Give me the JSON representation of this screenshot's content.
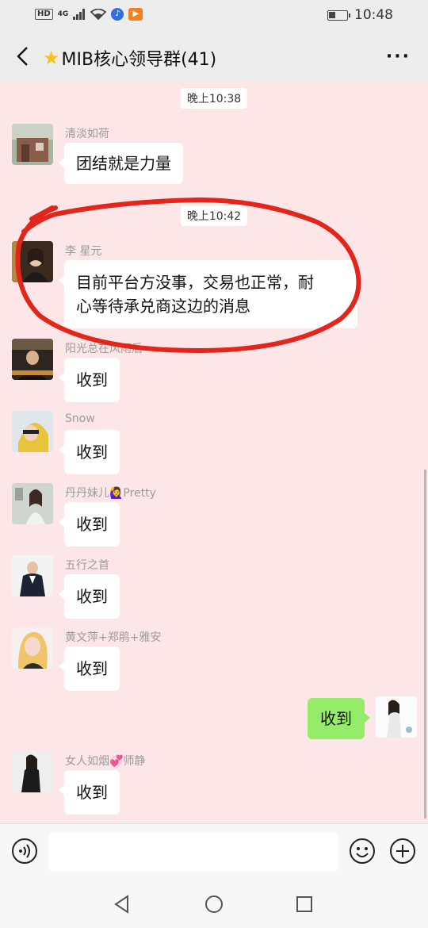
{
  "status_bar": {
    "left": {
      "hd": "HD",
      "network": "4G"
    },
    "right": {
      "battery_percent": 40,
      "time": "10:48"
    }
  },
  "header": {
    "title": "MIB核心领导群(41)"
  },
  "chat": {
    "timestamps": [
      "晚上10:38",
      "晚上10:42"
    ],
    "messages": [
      {
        "sender": "清淡如荷",
        "text": "团结就是力量"
      },
      {
        "sender": "李 星元",
        "text_line1": "目前平台方没事，交易也正常，耐",
        "text_line2": "心等待承兑商这边的消息"
      },
      {
        "sender": "阳光总在风雨后",
        "text": "收到"
      },
      {
        "sender": "Snow",
        "text": "收到"
      },
      {
        "sender": "丹丹妹儿🙋‍♀️Pretty",
        "text": "收到"
      },
      {
        "sender": "五行之首",
        "text": "收到"
      },
      {
        "sender": "黄文萍+郑鹃+雅安",
        "text": "收到"
      },
      {
        "sender": "女人如烟💞师静",
        "text": "收到"
      }
    ],
    "self_message": {
      "text": "收到"
    }
  },
  "input_bar": {
    "placeholder": ""
  }
}
